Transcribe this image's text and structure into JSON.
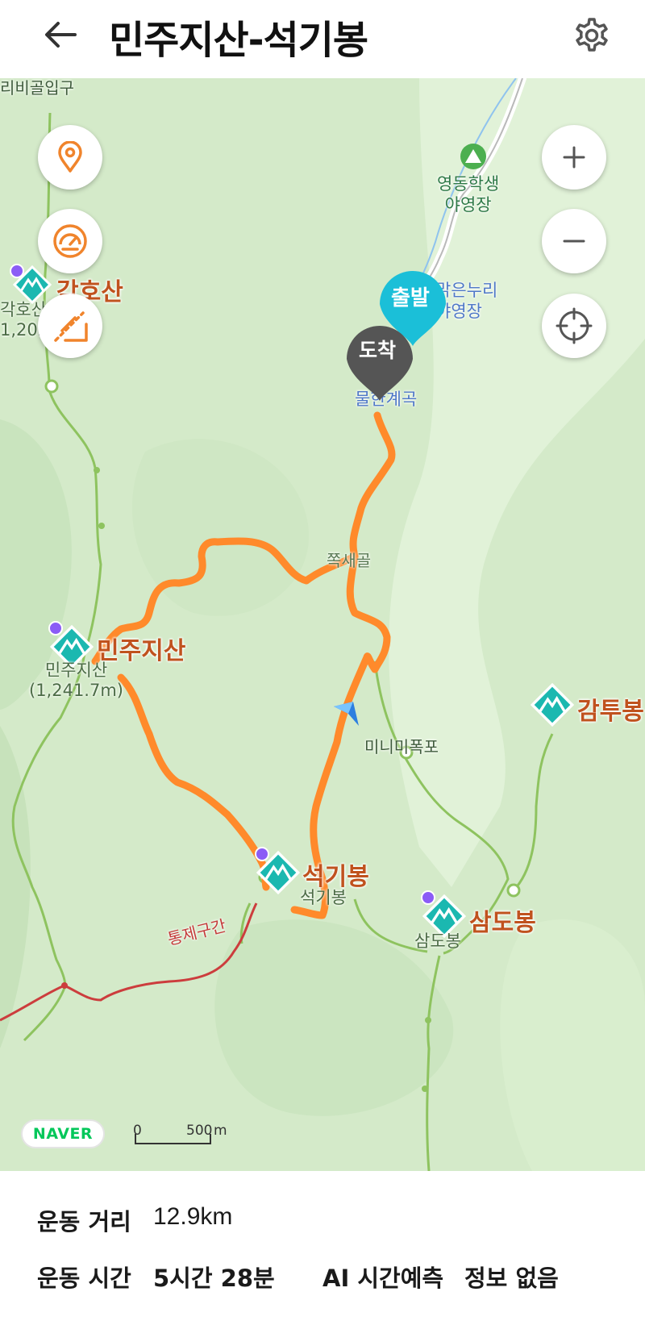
{
  "header": {
    "title": "민주지산-석기봉",
    "back_icon": "arrow-left-icon",
    "settings_icon": "gear-icon"
  },
  "map": {
    "left_controls": [
      "location-pin-icon",
      "speedometer-icon",
      "route-slope-icon"
    ],
    "right_controls": [
      "zoom-in-icon",
      "zoom-out-icon",
      "crosshair-icon"
    ],
    "labels": {
      "top_left": "리비골입구",
      "campsite1": [
        "영동학생",
        "야영장"
      ],
      "campsite2": [
        "맑은누리",
        "야영장"
      ],
      "valley": "물한계곡",
      "gol": "쪽새골",
      "gakhosan": "각호산",
      "gakhosan_sub": [
        "각호산",
        "1,202m"
      ],
      "minjujisan": "민주지산",
      "minjujisan_sub": [
        "민주지산",
        "(1,241.7m)"
      ],
      "seokgibong": "석기봉",
      "seokgibong_sub": "석기봉",
      "samdobong": "삼도봉",
      "samdobong_sub": "삼도봉",
      "gamtubong": "감투봉",
      "waterfall": "미니미폭포",
      "restricted": "통제구간"
    },
    "markers": {
      "start": "출발",
      "arrival": "도착"
    },
    "logo": "NAVER",
    "scale": {
      "zero": "0",
      "distance": "500",
      "unit": "m"
    },
    "colors": {
      "route": "#ff8a2b",
      "start": "#1bbfd8",
      "arrival": "#555555",
      "peak_icon": "#1bb8b0",
      "trail": "#8ec35f",
      "restricted": "#cc3d3d"
    }
  },
  "stats": {
    "distance_label": "운동 거리",
    "distance_value": "12.9km",
    "time_label": "운동 시간",
    "time_value": "5시간 28분",
    "ai_label": "AI 시간예측",
    "ai_value": "정보 없음"
  }
}
